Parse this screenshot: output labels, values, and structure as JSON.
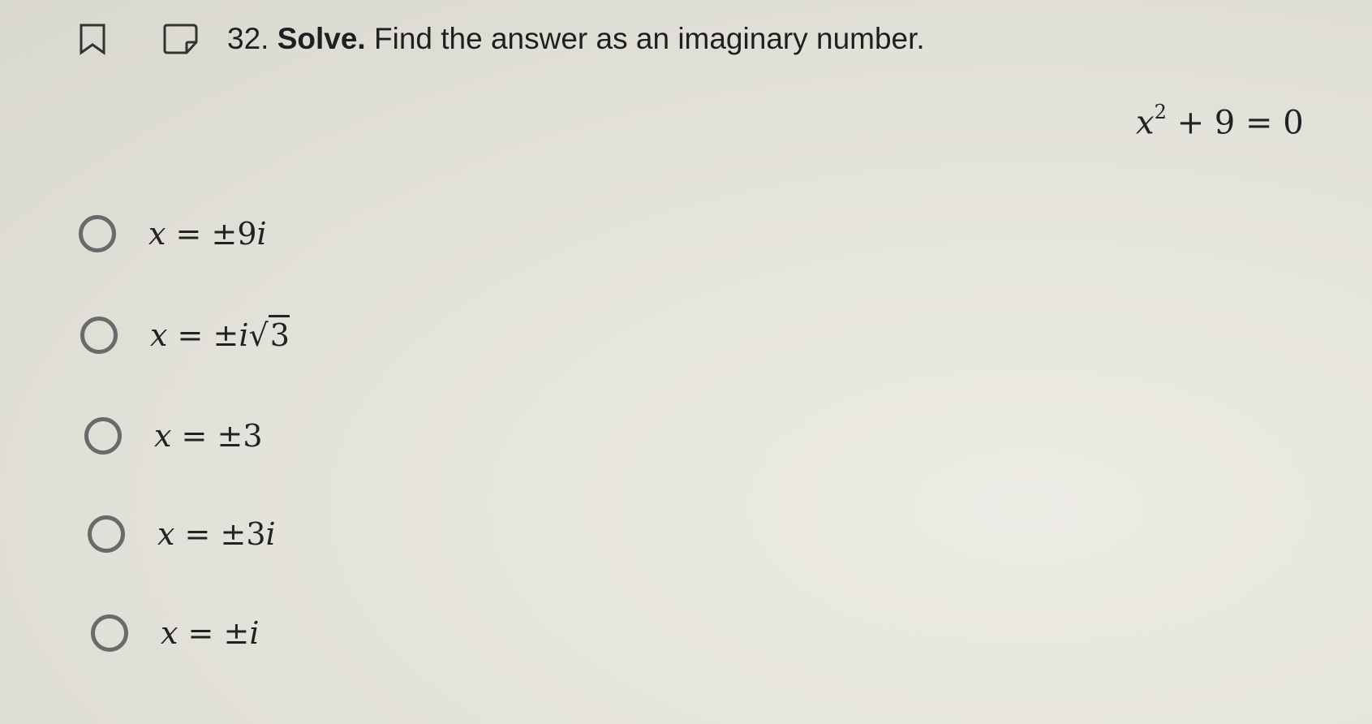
{
  "question": {
    "number": "32.",
    "bold_label": "Solve.",
    "prompt": "Find the answer as an imaginary number.",
    "equation": {
      "variable": "x",
      "exponent": "2",
      "rest": "+ 9 = 0"
    }
  },
  "toolbar": {
    "bookmark_icon": "bookmark-icon",
    "note_icon": "note-icon"
  },
  "options": [
    {
      "lhs": "x",
      "eq": "=",
      "pm": "±",
      "coef": "9",
      "unit": "i",
      "sqrt": ""
    },
    {
      "lhs": "x",
      "eq": "=",
      "pm": "±",
      "coef": "",
      "unit": "i",
      "sqrt": "3"
    },
    {
      "lhs": "x",
      "eq": "=",
      "pm": "±",
      "coef": "3",
      "unit": "",
      "sqrt": ""
    },
    {
      "lhs": "x",
      "eq": "=",
      "pm": "±",
      "coef": "3",
      "unit": "i",
      "sqrt": ""
    },
    {
      "lhs": "x",
      "eq": "=",
      "pm": "±",
      "coef": "",
      "unit": "i",
      "sqrt": ""
    }
  ],
  "colors": {
    "background": "#e5e4dc",
    "text": "#1f1f1f",
    "radio_border": "#6a6a6a"
  }
}
